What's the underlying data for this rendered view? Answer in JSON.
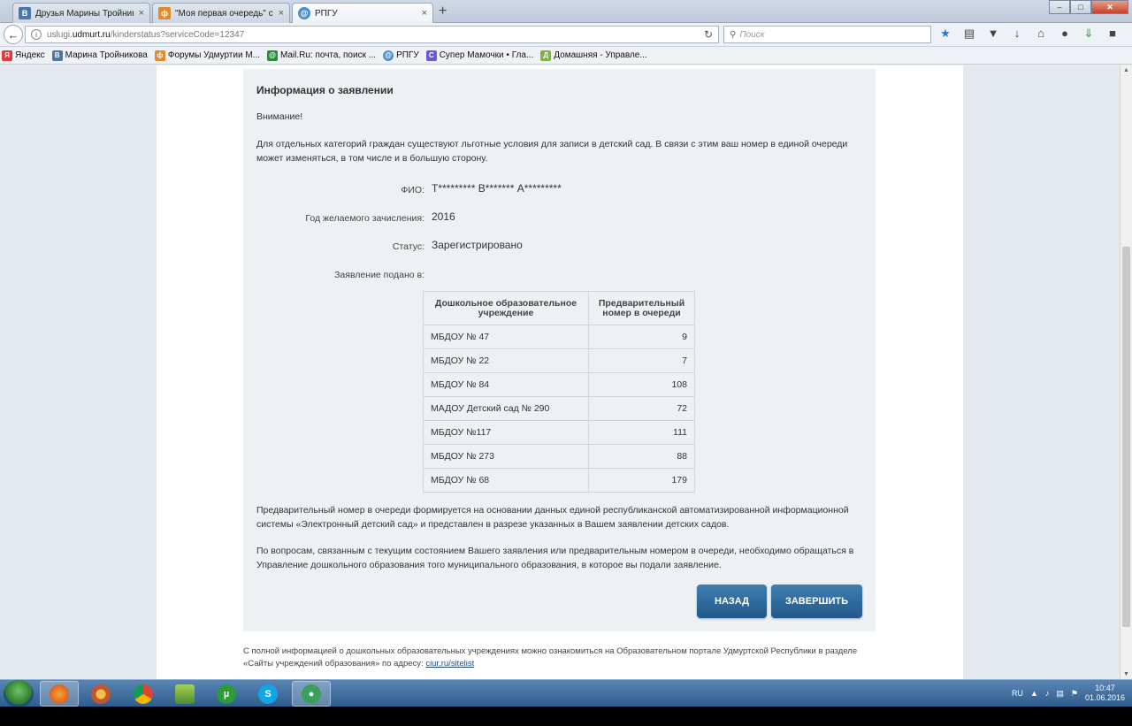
{
  "browser": {
    "tabs": [
      {
        "label": "Друзья Марины Тройник...",
        "icon": "vk-icon",
        "active": false
      },
      {
        "label": "\"Моя первая очередь\" ст...",
        "icon": "forum-icon",
        "active": false
      },
      {
        "label": "РПГУ",
        "icon": "at-icon",
        "active": true
      }
    ],
    "new_tab": "+",
    "url_prefix": "uslugi.",
    "url_domain": "udmurt.ru",
    "url_path": "/kinderstatus?serviceCode=12347",
    "search_placeholder": "Поиск",
    "bookmarks": [
      {
        "label": "Яндекс",
        "icon": "yandex-icon",
        "color": "#e53935",
        "glyph": "Я"
      },
      {
        "label": "Марина Тройникова",
        "icon": "vk-icon",
        "color": "#4a76a8",
        "glyph": "B"
      },
      {
        "label": "Форумы Удмуртии М...",
        "icon": "forum-icon",
        "color": "#e08a2a",
        "glyph": "ф"
      },
      {
        "label": "Mail.Ru: почта, поиск ...",
        "icon": "mailru-icon",
        "color": "#2b8a3e",
        "glyph": "@"
      },
      {
        "label": "РПГУ",
        "icon": "at-icon",
        "color": "#4a90c8",
        "glyph": "@"
      },
      {
        "label": "Супер Мамочки • Гла...",
        "icon": "moms-icon",
        "color": "#6a5acd",
        "glyph": "С"
      },
      {
        "label": "Домашняя - Управле...",
        "icon": "home-page-icon",
        "color": "#7cb342",
        "glyph": "Д"
      }
    ]
  },
  "content": {
    "title": "Информация о заявлении",
    "warning": "Внимание!",
    "notice": "Для отдельных категорий граждан существуют льготные условия для записи в детский сад. В связи с этим ваш номер в единой очереди может изменяться, в том числе и в большую сторону.",
    "fields": {
      "fio_label": "ФИО:",
      "fio_value": "Т********* В******* А*********",
      "year_label": "Год желаемого зачисления:",
      "year_value": "2016",
      "status_label": "Статус:",
      "status_value": "Зарегистрировано",
      "filed_label": "Заявление подано в:"
    },
    "table": {
      "headers": [
        "Дошкольное образовательное учреждение",
        "Предварительный номер в очереди"
      ],
      "rows": [
        [
          "МБДОУ № 47",
          "9"
        ],
        [
          "МБДОУ № 22",
          "7"
        ],
        [
          "МБДОУ № 84",
          "108"
        ],
        [
          "МАДОУ Детский сад № 290",
          "72"
        ],
        [
          "МБДОУ №117",
          "111"
        ],
        [
          "МБДОУ № 273",
          "88"
        ],
        [
          "МБДОУ № 68",
          "179"
        ]
      ]
    },
    "info1": "Предварительный номер в очереди формируется на основании данных единой республиканской автоматизированной информационной системы «Электронный детский сад» и представлен в разрезе указанных в Вашем заявлении детских садов.",
    "info2": "По вопросам, связанным с текущим состоянием Вашего заявления или предварительным номером в очереди, необходимо обращаться в Управление дошкольного образования того муниципального образования, в которое вы подали заявление.",
    "back_button": "НАЗАД",
    "finish_button": "ЗАВЕРШИТЬ"
  },
  "footer": {
    "text": "С полной информацией о дошкольных образовательных учреждениях можно ознакомиться на Образовательном портале Удмуртской Республики в разделе «Сайты учреждений образования» по адресу: ",
    "link": "ciur.ru/sitelist"
  },
  "taskbar": {
    "lang": "RU",
    "time": "10:47",
    "date": "01.06.2016"
  }
}
